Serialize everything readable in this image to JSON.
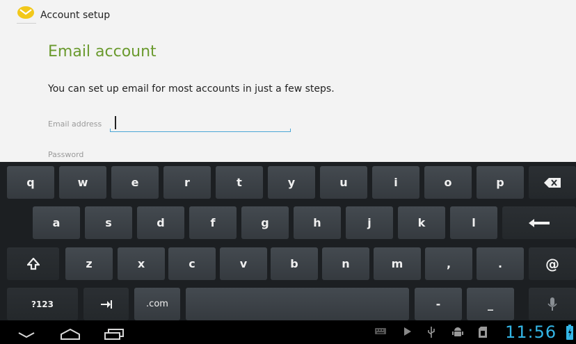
{
  "action_bar": {
    "title": "Account setup",
    "icon": "email-app-icon"
  },
  "screen": {
    "heading": "Email account",
    "description": "You can set up email for most accounts in just a few steps.",
    "email_label": "Email address",
    "email_value": "",
    "password_label": "Password"
  },
  "keyboard": {
    "row1": [
      "q",
      "w",
      "e",
      "r",
      "t",
      "y",
      "u",
      "i",
      "o",
      "p"
    ],
    "row2": [
      "a",
      "s",
      "d",
      "f",
      "g",
      "h",
      "j",
      "k",
      "l"
    ],
    "row3": [
      "z",
      "x",
      "c",
      "v",
      "b",
      "n",
      "m",
      ",",
      "."
    ],
    "at_key": "@",
    "symbols_key": "?123",
    "domain_key": ".com",
    "dash_key": "-",
    "underscore_key": "_",
    "icons": {
      "backspace": "backspace-icon",
      "enter": "enter-icon",
      "shift": "shift-icon",
      "tab": "tab-icon",
      "mic": "microphone-icon"
    }
  },
  "nav_bar": {
    "icons": [
      "back-icon",
      "home-icon",
      "recent-apps-icon"
    ],
    "status_icons": [
      "keyboard-icon",
      "play-store-icon",
      "usb-icon",
      "android-debug-icon",
      "sd-card-icon",
      "battery-icon"
    ],
    "clock": "11:56",
    "accent": "#33b5e5"
  }
}
